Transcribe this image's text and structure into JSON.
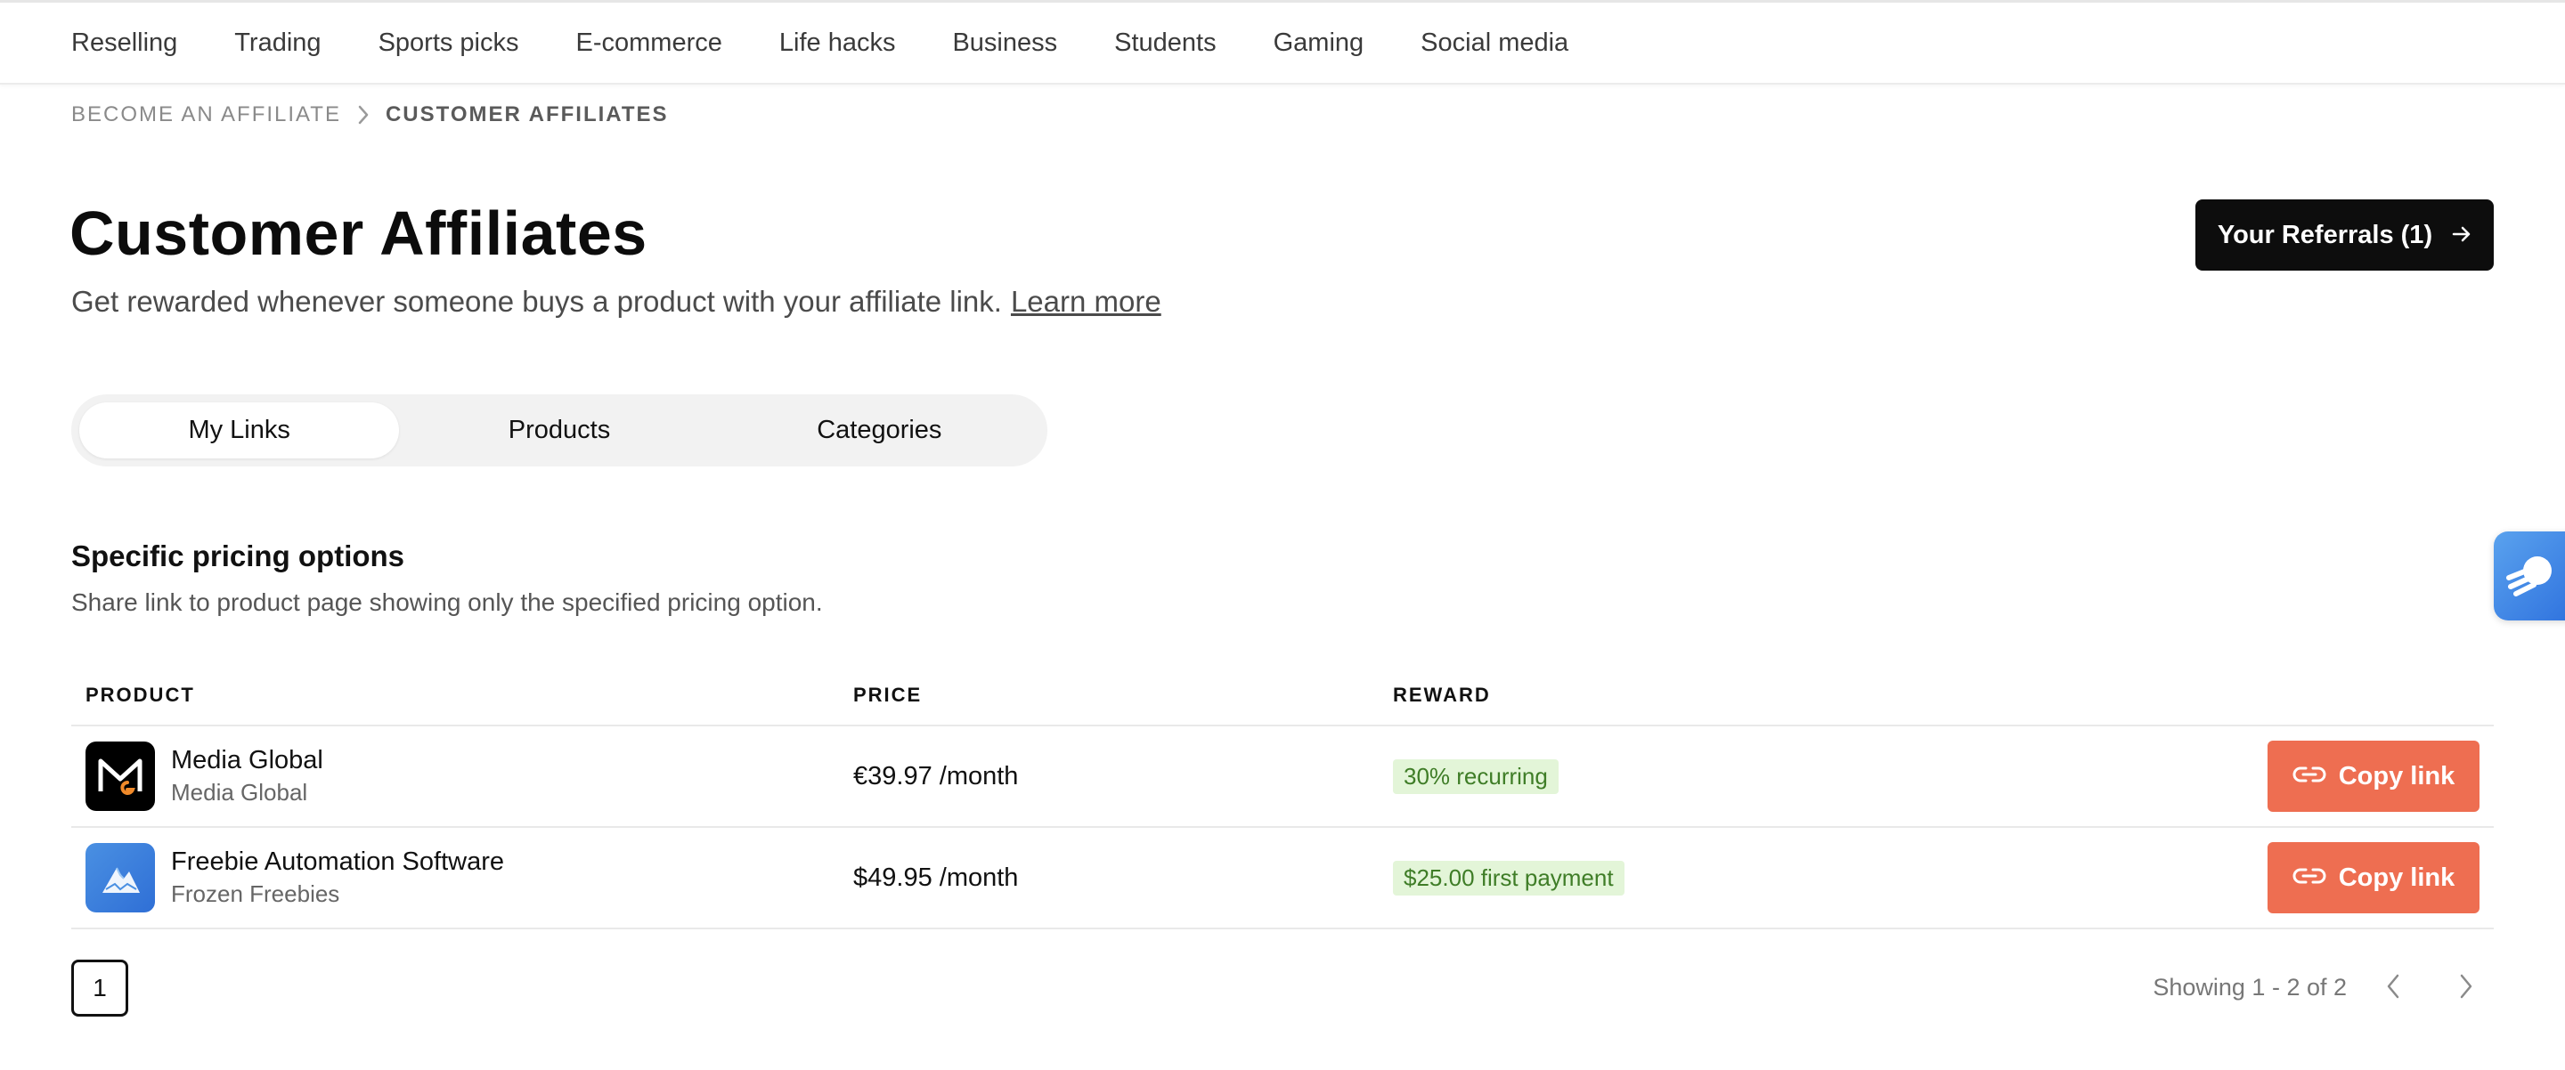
{
  "nav": {
    "items": [
      "Reselling",
      "Trading",
      "Sports picks",
      "E-commerce",
      "Life hacks",
      "Business",
      "Students",
      "Gaming",
      "Social media"
    ]
  },
  "breadcrumb": {
    "parent": "Become an affiliate",
    "current": "Customer affiliates"
  },
  "header": {
    "title": "Customer Affiliates",
    "subtitle": "Get rewarded whenever someone buys a product with your affiliate link.",
    "learn_more": "Learn more",
    "referrals_button": "Your Referrals (1)"
  },
  "tabs": [
    {
      "label": "My Links",
      "active": true
    },
    {
      "label": "Products",
      "active": false
    },
    {
      "label": "Categories",
      "active": false
    }
  ],
  "section": {
    "title": "Specific pricing options",
    "description": "Share link to product page showing only the specified pricing option."
  },
  "table": {
    "headers": {
      "product": "PRODUCT",
      "price": "PRICE",
      "reward": "REWARD"
    },
    "rows": [
      {
        "name": "Media Global",
        "seller": "Media Global",
        "price": "€39.97 /month",
        "reward": "30% recurring",
        "action": "Copy link",
        "logo": "media-global-logo"
      },
      {
        "name": "Freebie Automation Software",
        "seller": "Frozen Freebies",
        "price": "$49.95 /month",
        "reward": "$25.00 first payment",
        "action": "Copy link",
        "logo": "frozen-freebies-logo"
      }
    ]
  },
  "pagination": {
    "current_page": "1",
    "showing": "Showing 1 - 2 of 2"
  },
  "colors": {
    "accent": "#ee6e51",
    "reward_bg": "#e3f5d8",
    "reward_text": "#3f7d27",
    "primary_button": "#0d0d0d"
  }
}
